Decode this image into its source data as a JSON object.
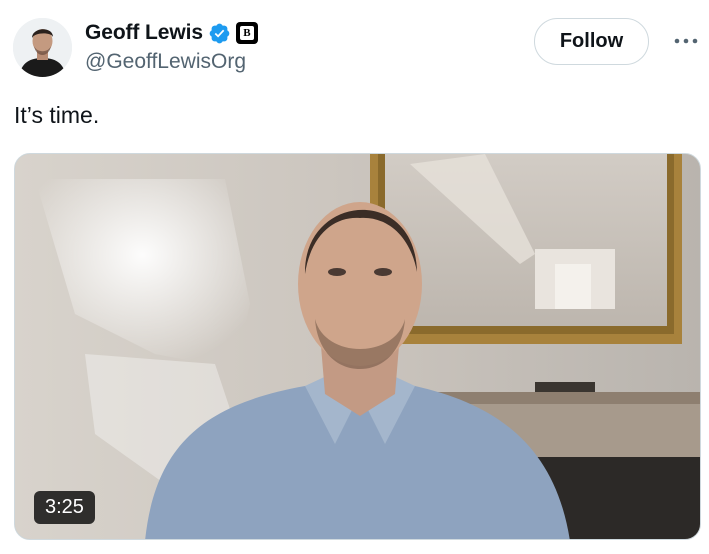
{
  "author": {
    "display_name": "Geoff Lewis",
    "handle": "@GeoffLewisOrg",
    "verified": true,
    "affiliate_badge_letter": "B"
  },
  "actions": {
    "follow_label": "Follow",
    "more_icon": "more-horizontal-icon"
  },
  "tweet": {
    "text": "It’s time."
  },
  "media": {
    "type": "video",
    "duration": "3:25"
  },
  "colors": {
    "text_primary": "#0f1419",
    "text_secondary": "#536471",
    "verified_blue": "#1d9bf0",
    "border": "#cfd9de"
  }
}
